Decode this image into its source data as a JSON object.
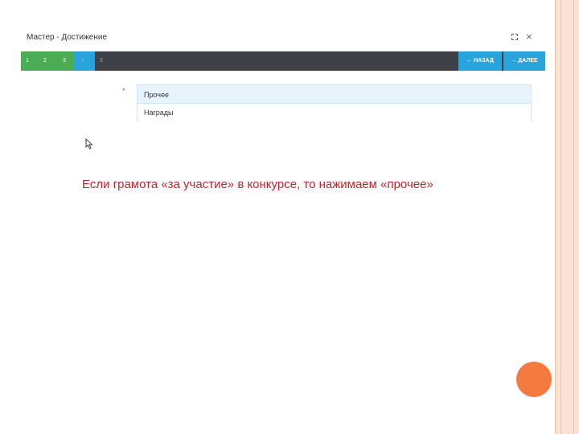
{
  "dialog": {
    "title": "Мастер - Достижение",
    "maximize_icon": "maximize-icon",
    "close_icon": "×"
  },
  "steps": {
    "items": [
      "1",
      "2",
      "3",
      "4",
      "5"
    ],
    "current": 3,
    "completed_color": "#4aad54",
    "current_color": "#29a3dc",
    "bar_color": "#3e4148"
  },
  "nav": {
    "back_label": "НАЗАД",
    "next_label": "ДАЛЕЕ",
    "back_icon": "arrow-left-icon",
    "next_icon": "arrow-right-icon"
  },
  "options": {
    "required_mark": "*",
    "items": [
      "Прочее",
      "Награды"
    ],
    "highlighted": "Прочее"
  },
  "caption": "Если грамота «за участие» в конкурсе, то нажимаем «прочее»",
  "colors": {
    "caption": "#c0262d",
    "accent_circle": "#f47a40",
    "slide_border": "#fbe2d4"
  }
}
